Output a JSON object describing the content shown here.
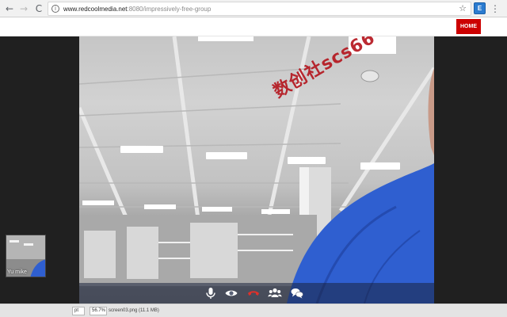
{
  "browser": {
    "back_glyph": "←",
    "forward_glyph": "→",
    "reload_glyph": "C",
    "info_glyph": "i",
    "url_host": "www.redcoolmedia.net",
    "url_path": ":8080/impressively-free-group",
    "star_glyph": "☆",
    "extension_glyph": "E",
    "menu_glyph": "⋮"
  },
  "site": {
    "home_label": "HOME"
  },
  "video": {
    "watermark": "数创社scs66",
    "self_label": "Yu mike"
  },
  "controls": {
    "icons": [
      "microphone-icon",
      "eye-icon",
      "hangup-icon",
      "users-icon",
      "chat-icon"
    ],
    "hangup_color": "#e0302a"
  },
  "status": {
    "page_value": "pt",
    "zoom_value": "56.7%",
    "file_info": "screen03.png (11.1 MB)"
  },
  "colors": {
    "accent": "#cc0000",
    "stage_bg": "#202020",
    "shirt": "#2f5fd0"
  }
}
